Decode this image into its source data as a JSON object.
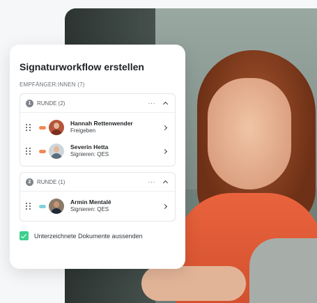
{
  "card": {
    "title": "Signaturworkflow erstellen",
    "recipients_label": "EMPFÄNGER:INNEN (7)"
  },
  "rounds": [
    {
      "number": "1",
      "label": "RUNDE (2)",
      "menu": "···",
      "recipients": [
        {
          "name": "Hannah Rettenwender",
          "role": "Freigeben",
          "tag_color": "#f08a56"
        },
        {
          "name": "Severin Hetta",
          "role": "Signieren: QES",
          "tag_color": "#f08a56"
        }
      ]
    },
    {
      "number": "2",
      "label": "RUNDE (1)",
      "menu": "···",
      "recipients": [
        {
          "name": "Armin Mentalé",
          "role": "Signieren: QES",
          "tag_color": "#7fd3d7"
        }
      ]
    }
  ],
  "send_documents": {
    "label": "Unterzeichnete Dokumente aussenden",
    "checked": true
  },
  "colors": {
    "accent_green": "#3ecf8e",
    "round1_tag": "#f08a56",
    "round2_tag": "#7fd3d7"
  }
}
